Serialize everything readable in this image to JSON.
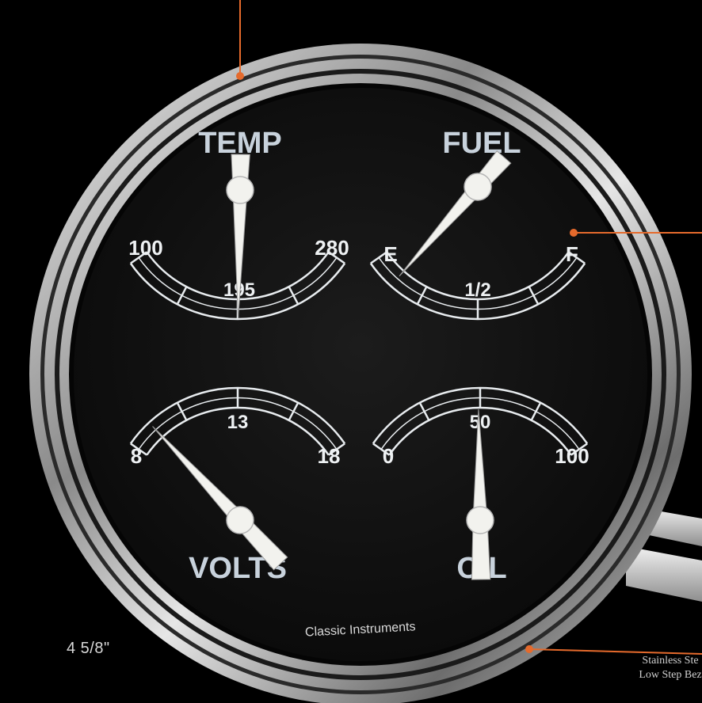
{
  "colors": {
    "background": "#000000",
    "dial": "#111111",
    "chrome": "#cfcfcf",
    "markings": "#e8ecef",
    "needle": "#f2f2ee",
    "callout": "#e56a2c"
  },
  "gauge": {
    "brand": "Classic Instruments",
    "size_label": "4 5/8\"",
    "bezel_callout": [
      "Stainless Ste",
      "Low Step Bez"
    ],
    "temp": {
      "title": "TEMP",
      "min": "100",
      "mid": "195",
      "max": "280",
      "value_fraction": 0.49
    },
    "fuel": {
      "title": "FUEL",
      "min": "E",
      "mid": "1/2",
      "max": "F",
      "value_fraction": 0.02
    },
    "volts": {
      "title": "VOLTS",
      "min": "8",
      "mid": "13",
      "max": "18",
      "value_fraction": 0.0
    },
    "oil": {
      "title": "OIL",
      "min": "0",
      "mid": "50",
      "max": "100",
      "value_fraction": 0.49
    }
  }
}
